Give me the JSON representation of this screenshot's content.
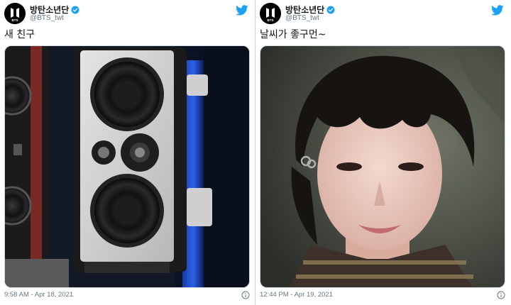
{
  "colors": {
    "twitter_blue": "#1da1f2",
    "verified_blue": "#1da1f2",
    "text": "#14171a",
    "muted": "#657786"
  },
  "tweets": [
    {
      "display_name": "방탄소년단",
      "handle": "@BTS_twt",
      "avatar_text": "BTS",
      "text": "새 친구",
      "timestamp": "9:58 AM - Apr 18, 2021",
      "media_icon": "studio-speaker-photo"
    },
    {
      "display_name": "방탄소년단",
      "handle": "@BTS_twt",
      "avatar_text": "BTS",
      "text": "날씨가 좋구먼~",
      "timestamp": "12:44 PM - Apr 19, 2021",
      "media_icon": "selfie-photo"
    }
  ]
}
